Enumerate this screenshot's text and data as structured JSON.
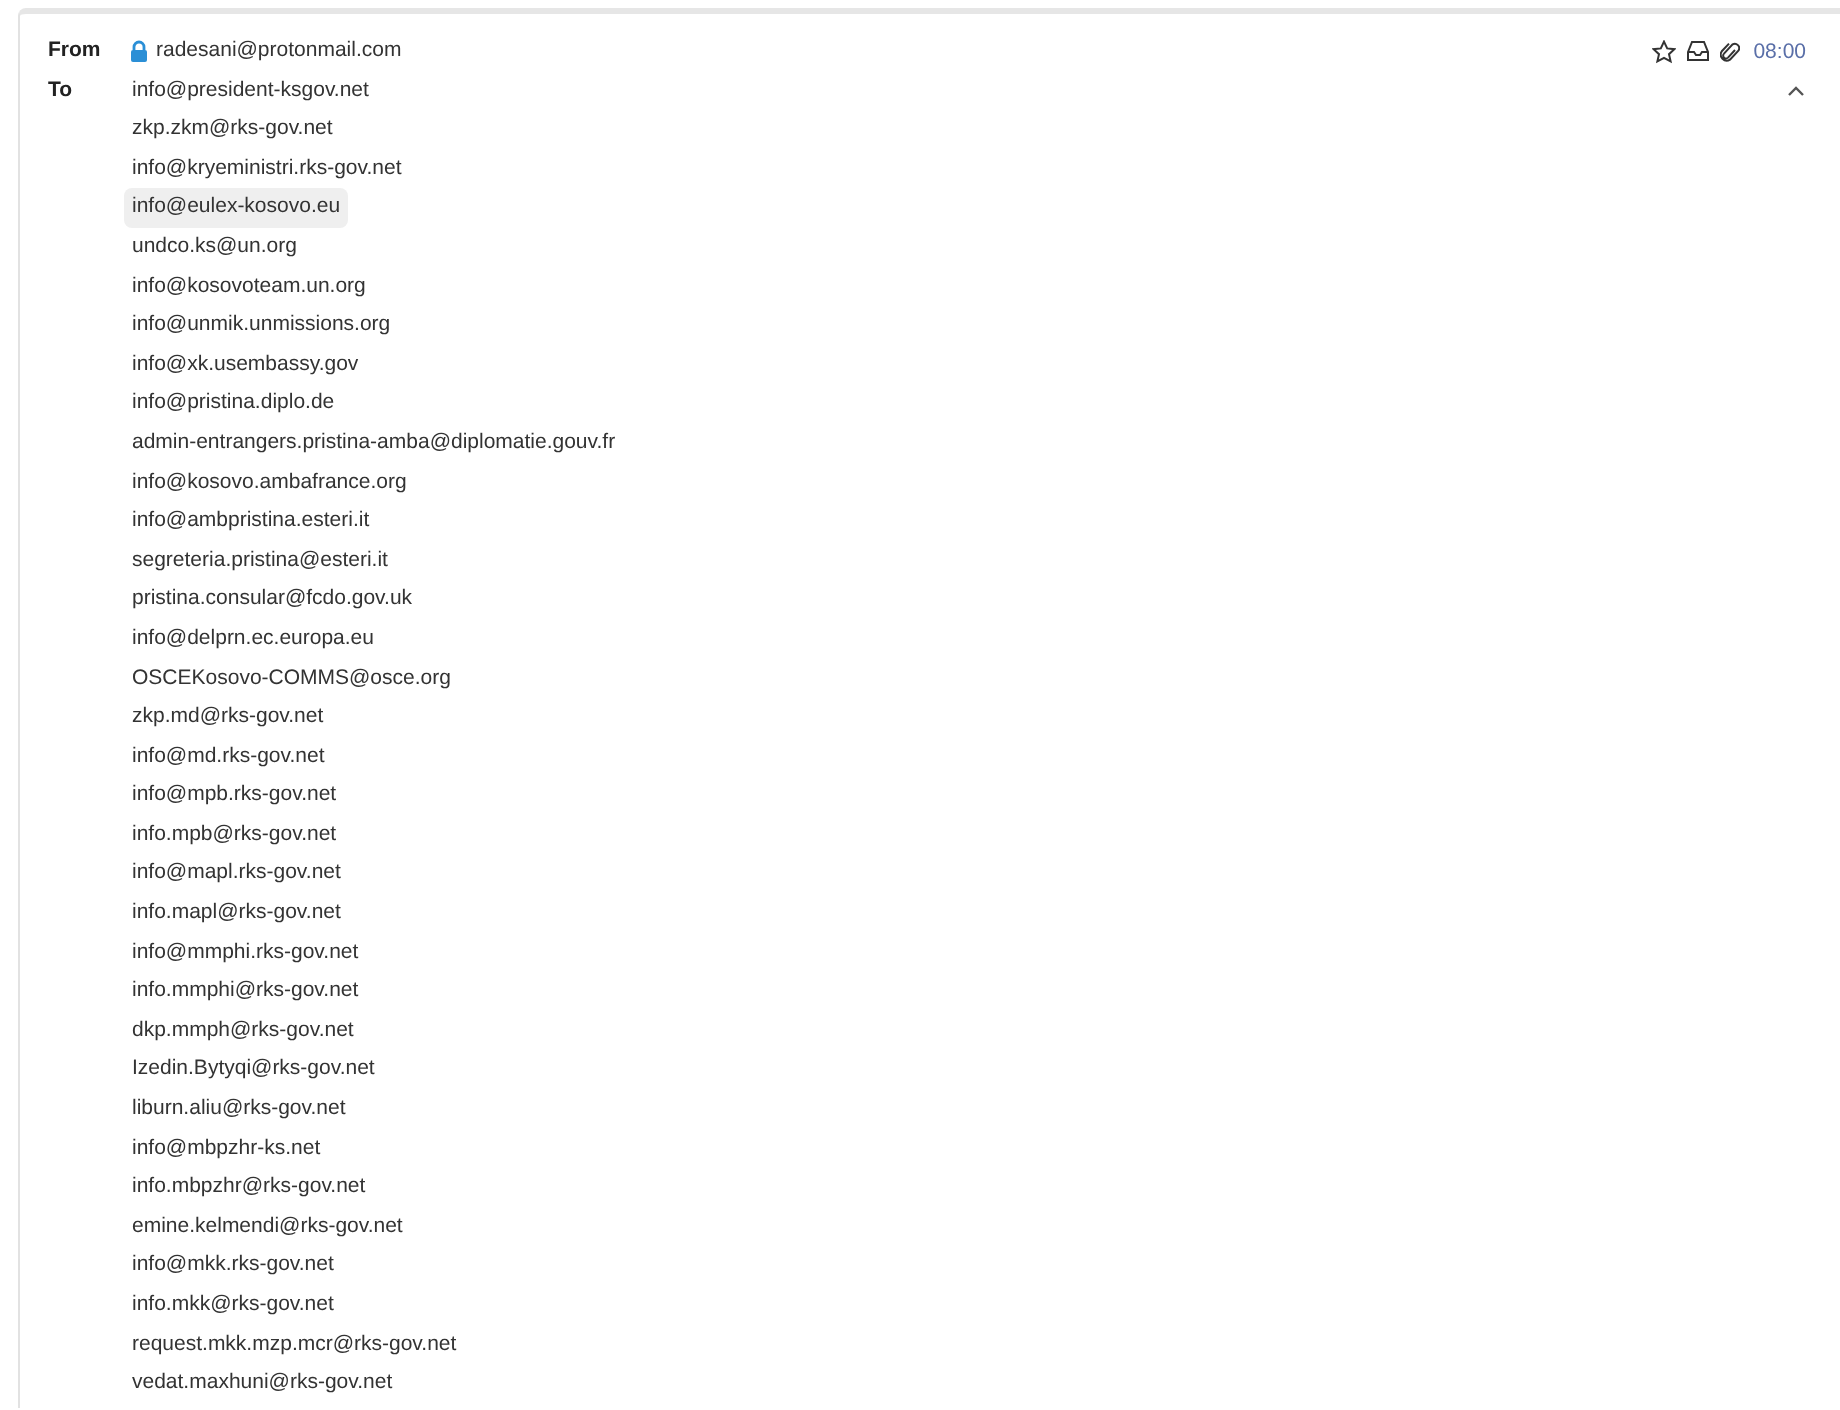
{
  "from": {
    "label": "From",
    "address": "radesani@protonmail.com",
    "encrypted": true
  },
  "time": "08:00",
  "starred": false,
  "has_attachment": true,
  "to": {
    "label": "To",
    "recipients": [
      {
        "address": "info@president-ksgov.net",
        "selected": false
      },
      {
        "address": "zkp.zkm@rks-gov.net",
        "selected": false
      },
      {
        "address": "info@kryeministri.rks-gov.net",
        "selected": false
      },
      {
        "address": "info@eulex-kosovo.eu",
        "selected": true
      },
      {
        "address": "undco.ks@un.org",
        "selected": false
      },
      {
        "address": "info@kosovoteam.un.org",
        "selected": false
      },
      {
        "address": "info@unmik.unmissions.org",
        "selected": false
      },
      {
        "address": "info@xk.usembassy.gov",
        "selected": false
      },
      {
        "address": "info@pristina.diplo.de",
        "selected": false
      },
      {
        "address": "admin-entrangers.pristina-amba@diplomatie.gouv.fr",
        "selected": false
      },
      {
        "address": "info@kosovo.ambafrance.org",
        "selected": false
      },
      {
        "address": "info@ambpristina.esteri.it",
        "selected": false
      },
      {
        "address": "segreteria.pristina@esteri.it",
        "selected": false
      },
      {
        "address": "pristina.consular@fcdo.gov.uk",
        "selected": false
      },
      {
        "address": "info@delprn.ec.europa.eu",
        "selected": false
      },
      {
        "address": "OSCEKosovo-COMMS@osce.org",
        "selected": false
      },
      {
        "address": "zkp.md@rks-gov.net",
        "selected": false
      },
      {
        "address": "info@md.rks-gov.net",
        "selected": false
      },
      {
        "address": "info@mpb.rks-gov.net",
        "selected": false
      },
      {
        "address": "info.mpb@rks-gov.net",
        "selected": false
      },
      {
        "address": "info@mapl.rks-gov.net",
        "selected": false
      },
      {
        "address": "info.mapl@rks-gov.net",
        "selected": false
      },
      {
        "address": "info@mmphi.rks-gov.net",
        "selected": false
      },
      {
        "address": "info.mmphi@rks-gov.net",
        "selected": false
      },
      {
        "address": "dkp.mmph@rks-gov.net",
        "selected": false
      },
      {
        "address": "Izedin.Bytyqi@rks-gov.net",
        "selected": false
      },
      {
        "address": "liburn.aliu@rks-gov.net",
        "selected": false
      },
      {
        "address": "info@mbpzhr-ks.net",
        "selected": false
      },
      {
        "address": "info.mbpzhr@rks-gov.net",
        "selected": false
      },
      {
        "address": "emine.kelmendi@rks-gov.net",
        "selected": false
      },
      {
        "address": "info@mkk.rks-gov.net",
        "selected": false
      },
      {
        "address": "info.mkk@rks-gov.net",
        "selected": false
      },
      {
        "address": "request.mkk.mzp.mcr@rks-gov.net",
        "selected": false
      },
      {
        "address": "vedat.maxhuni@rks-gov.net",
        "selected": false
      }
    ]
  },
  "expanded": true
}
